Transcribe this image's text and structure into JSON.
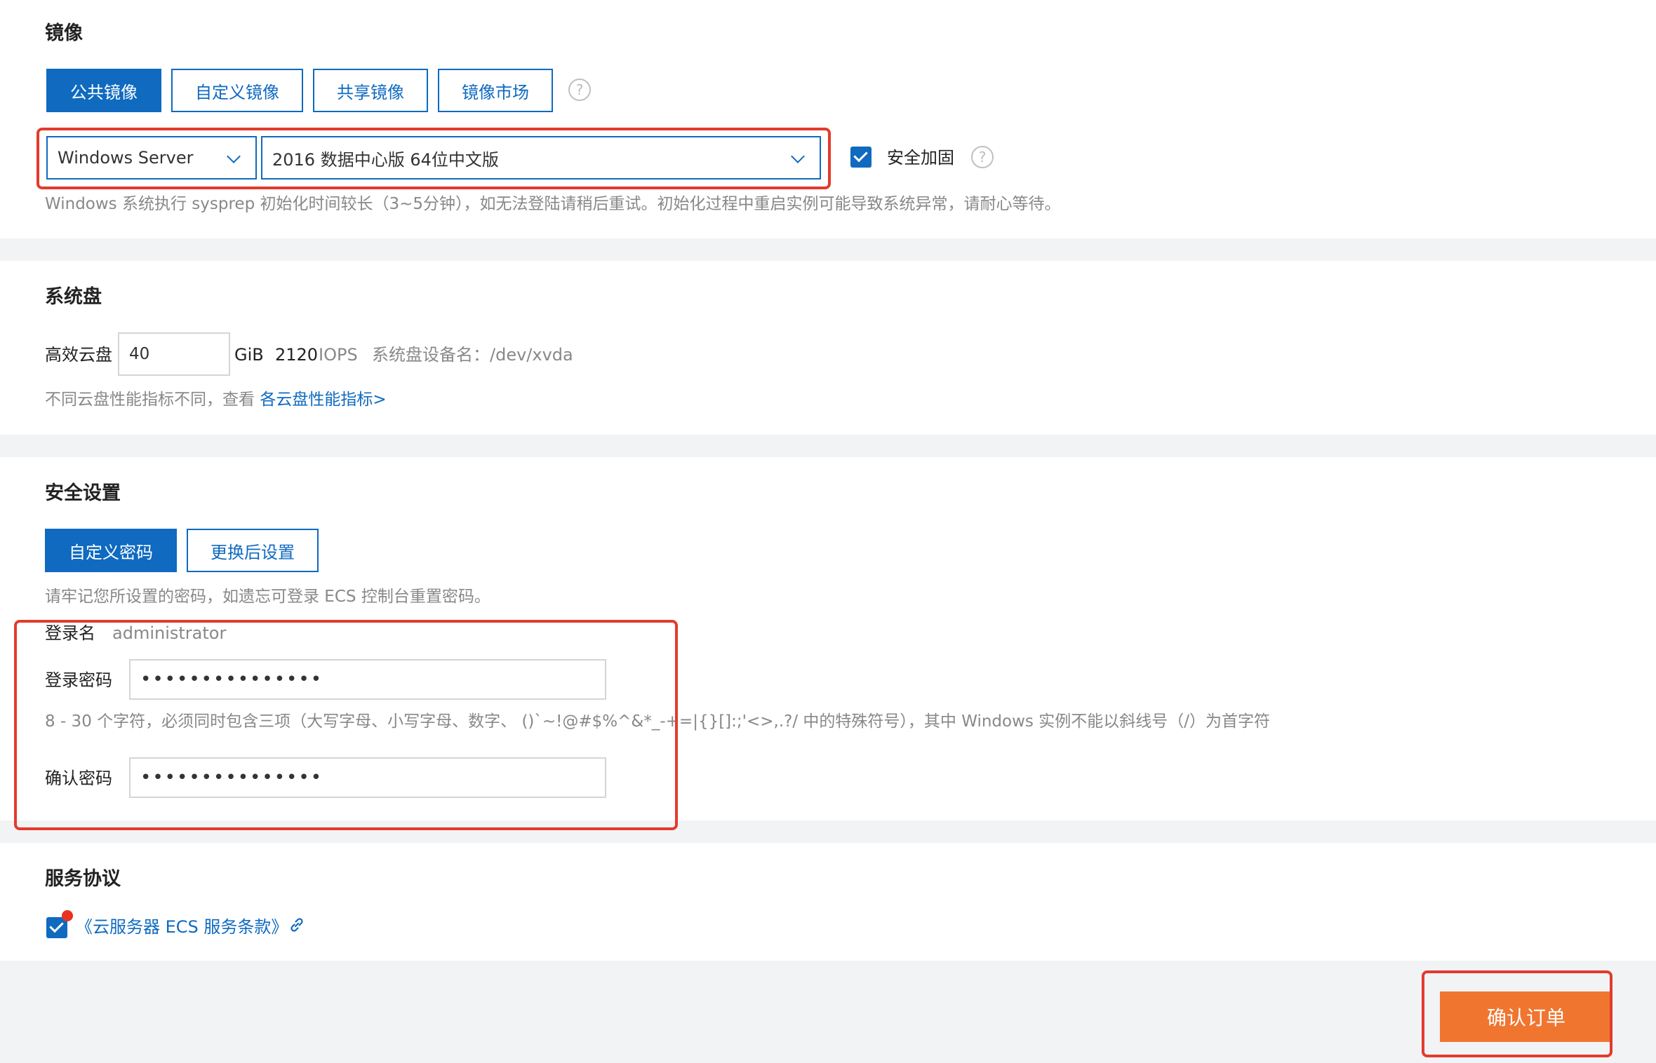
{
  "image_section": {
    "title": "镜像",
    "tabs": [
      "公共镜像",
      "自定义镜像",
      "共享镜像",
      "镜像市场"
    ],
    "os_select": "Windows Server",
    "version_select": "2016 数据中心版 64位中文版",
    "security_hardening_label": "安全加固",
    "note": "Windows 系统执行 sysprep 初始化时间较长（3~5分钟），如无法登陆请稍后重试。初始化过程中重启实例可能导致系统异常，请耐心等待。"
  },
  "disk_section": {
    "title": "系统盘",
    "disk_type": "高效云盘",
    "size_value": "40",
    "unit": "GiB",
    "iops_value": "2120",
    "iops_label": "IOPS",
    "device_name": "系统盘设备名：/dev/xvda",
    "note_prefix": "不同云盘性能指标不同，查看",
    "note_link": "各云盘性能指标>"
  },
  "security_section": {
    "title": "安全设置",
    "tabs": [
      "自定义密码",
      "更换后设置"
    ],
    "note": "请牢记您所设置的密码，如遗忘可登录 ECS 控制台重置密码。",
    "login_name_label": "登录名",
    "login_name_value": "administrator",
    "password_label": "登录密码",
    "password_value": "•••••••••••••••",
    "password_rule": "8 - 30 个字符，必须同时包含三项（大写字母、小写字母、数字、 ()`~!@#$%^&*_-+=|{}[]:;'<>,.?/ 中的特殊符号），其中 Windows 实例不能以斜线号（/）为首字符",
    "confirm_label": "确认密码",
    "confirm_value": "•••••••••••••••"
  },
  "agreement_section": {
    "title": "服务协议",
    "link_text": "《云服务器 ECS 服务条款》"
  },
  "footer": {
    "confirm_button": "确认订单"
  },
  "colors": {
    "primary": "#0f6ac0",
    "highlight_border": "#e23b2e",
    "confirm_button": "#f07630",
    "notification_dot": "#e8311f"
  },
  "icons": {
    "help": "question-circle-icon",
    "dropdown": "chevron-down-icon",
    "external_link": "link-icon",
    "checkbox": "checkmark-icon"
  }
}
